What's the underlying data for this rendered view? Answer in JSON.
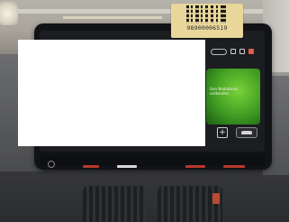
{
  "image": {
    "subject": "car-infotainment-display",
    "qr_label": {
      "number": "98900006519"
    },
    "screen": {
      "title_text": "",
      "green_widget_text": "Gen Nodokaran verbanden",
      "plus_symbol": "+"
    },
    "colors": {
      "accent_green": "#4fae28",
      "slider_red": "#b53a2b",
      "label_yellow": "#e8d69a"
    }
  }
}
